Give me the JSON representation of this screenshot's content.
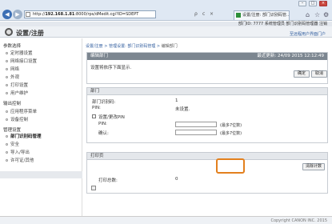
{
  "window": {
    "minimize": "–",
    "maximize": "□",
    "close": "×"
  },
  "browser": {
    "back": "◀",
    "forward": "▶",
    "url_prefix": "http://",
    "url_host": "192.168.1.81",
    "url_rest": ":8000/rps/dMedit.cgi?ID=SDEPT",
    "search": "ρ",
    "reload": "c",
    "stop": "×",
    "tab_title": "设置/注册: 部门识别码管...",
    "home": "⌂",
    "favorites": "☆",
    "tools": "⚙"
  },
  "header": {
    "top_links": "部门ID: 7777  系统管理员 部门识别码管理器  注销",
    "title": "设置/注册",
    "portal_link": "至远程用户界面门户"
  },
  "sidebar": {
    "sections": [
      {
        "title": "参数选择",
        "items": [
          "定时器设置",
          "网络接口设置",
          "网络",
          "外观",
          "打印设置",
          "用户维护"
        ]
      },
      {
        "title": "输出控制",
        "items": [
          "应用程序菜单",
          "设备控制"
        ]
      },
      {
        "title": "管理设置",
        "items": [
          "部门识别码管理",
          "安全",
          "导入/导出",
          "许可证/其他"
        ]
      }
    ],
    "active": "部门识别码管理"
  },
  "main": {
    "breadcrumb": {
      "part1": "设置/注册",
      "sep": " > ",
      "part2": "管理设置: 部门识别码管理",
      "current": "编辑部门"
    },
    "panel1": {
      "title": "编辑部门",
      "timestamp": "最近更新: 24/09 2015 12:12:49",
      "message": "设置将依序下面显示.",
      "ok_button": "确定",
      "cancel_button": "取消"
    },
    "panel2": {
      "title": "部门",
      "dept_id_label": "部门识别码:",
      "dept_id_value": "1",
      "pin_label": "PIN:",
      "pin_value": "未设置.",
      "set_pin_label": "设置/更改PIN",
      "pin_field_label": "PIN:",
      "pin_hint": "(最多7位数)",
      "confirm_label": "确认:",
      "confirm_hint": "(最多7位数)"
    },
    "panel3": {
      "title": "打印页",
      "clear_button": "清除计数",
      "total_label": "打印总数:",
      "total_value": "0"
    }
  },
  "footer": {
    "copyright": "Copyright CANON INC. 2015"
  }
}
